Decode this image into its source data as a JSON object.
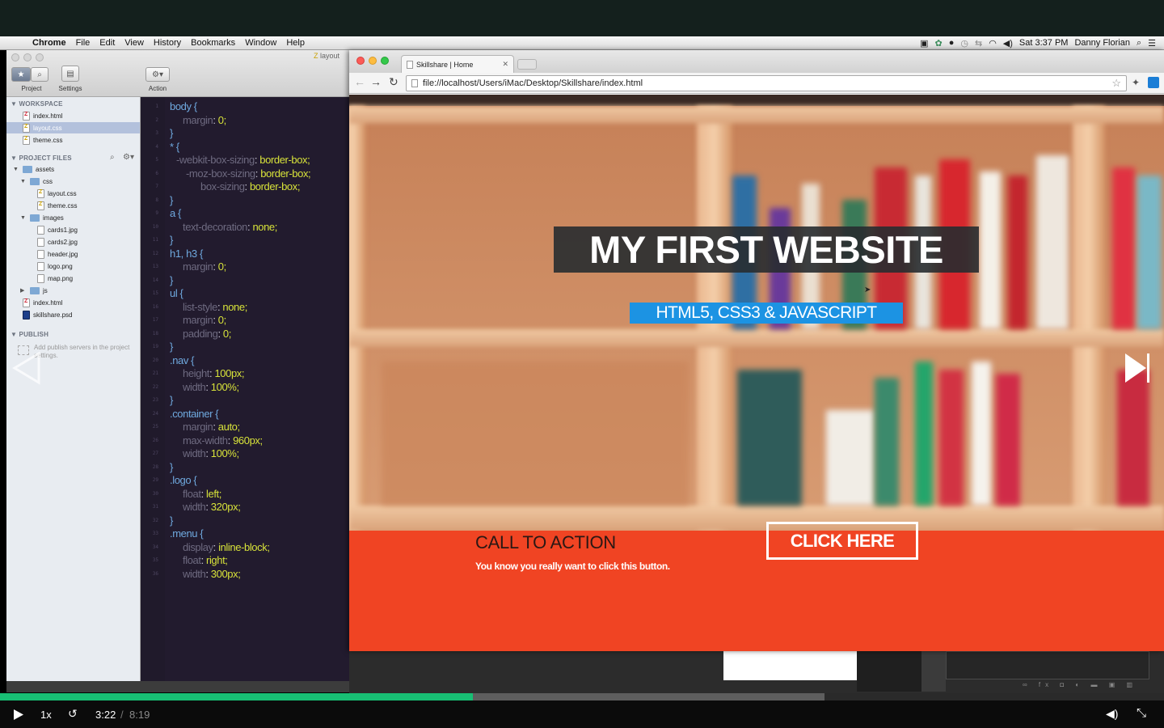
{
  "menubar": {
    "app": "Chrome",
    "items": [
      "File",
      "Edit",
      "View",
      "History",
      "Bookmarks",
      "Window",
      "Help"
    ],
    "clock": "Sat 3:37 PM",
    "user": "Danny Florian"
  },
  "editor": {
    "file_tab": "layout",
    "toolbar": {
      "project_label": "Project",
      "settings_label": "Settings",
      "action_label": "Action"
    },
    "sidebar": {
      "workspace_header": "WORKSPACE",
      "workspace_files": [
        "index.html",
        "layout.css",
        "theme.css"
      ],
      "project_files_header": "PROJECT FILES",
      "tree": {
        "assets": "assets",
        "css": "css",
        "css_files": [
          "layout.css",
          "theme.css"
        ],
        "images": "images",
        "image_files": [
          "cards1.jpg",
          "cards2.jpg",
          "header.jpg",
          "logo.png",
          "map.png"
        ],
        "js": "js",
        "root_files": [
          "index.html",
          "skillshare.psd"
        ]
      },
      "publish_header": "PUBLISH",
      "publish_hint": "Add publish servers in the project settings."
    },
    "code": [
      {
        "sel": "body {"
      },
      {
        "prop": "margin",
        "val": "0;"
      },
      {
        "close": "}"
      },
      {
        "sel": "* {"
      },
      {
        "prop": "-webkit-box-sizing",
        "val": "border-box;"
      },
      {
        "prop": "-moz-box-sizing",
        "val": "border-box;"
      },
      {
        "prop": "box-sizing",
        "val": "border-box;"
      },
      {
        "close": "}"
      },
      {
        "sel": "a {"
      },
      {
        "prop": "text-decoration",
        "val": "none;"
      },
      {
        "close": "}"
      },
      {
        "sel": "h1, h3 {"
      },
      {
        "prop": "margin",
        "val": "0;"
      },
      {
        "close": "}"
      },
      {
        "sel": "ul {"
      },
      {
        "prop": "list-style",
        "val": "none;"
      },
      {
        "prop": "margin",
        "val": "0;"
      },
      {
        "prop": "padding",
        "val": "0;"
      },
      {
        "close": "}"
      },
      {
        "sel": ".nav {"
      },
      {
        "prop": "height",
        "val": "100px;"
      },
      {
        "prop": "width",
        "val": "100%;"
      },
      {
        "close": "}"
      },
      {
        "sel": ".container {"
      },
      {
        "prop": "margin",
        "val": "auto;"
      },
      {
        "prop": "max-width",
        "val": "960px;"
      },
      {
        "prop": "width",
        "val": "100%;"
      },
      {
        "close": "}"
      },
      {
        "sel": ".logo {"
      },
      {
        "prop": "float",
        "val": "left;"
      },
      {
        "prop": "width",
        "val": "320px;"
      },
      {
        "close": "}"
      },
      {
        "sel": ".menu {"
      },
      {
        "prop": "display",
        "val": "inline-block;"
      },
      {
        "prop": "float",
        "val": "right;"
      },
      {
        "prop": "width",
        "val": "300px;"
      }
    ]
  },
  "browser": {
    "tab_title": "Skillshare | Home",
    "url": "file://localhost/Users/iMac/Desktop/Skillshare/index.html"
  },
  "website": {
    "hero_title": "MY FIRST WEBSITE",
    "hero_subtitle": "HTML5, CSS3 & JAVASCRIPT",
    "cta_heading": "CALL TO ACTION",
    "cta_text": "You know you really want to click this button.",
    "cta_button": "CLICK HERE"
  },
  "player": {
    "speed": "1x",
    "time_current": "3:22",
    "time_separator": "/",
    "time_total": "8:19",
    "progress_played": 0.406,
    "progress_buffered": 0.708,
    "accent": "#18bf74"
  }
}
